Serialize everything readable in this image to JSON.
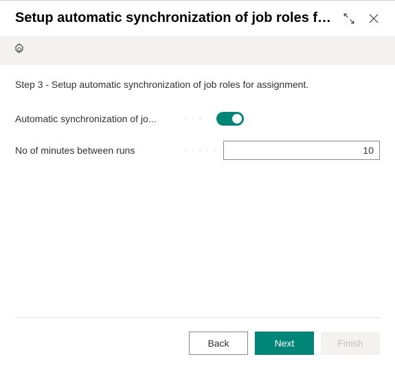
{
  "header": {
    "title": "Setup automatic synchronization of job roles fo..."
  },
  "step": {
    "text": "Step 3 - Setup automatic synchronization of job roles for assignment."
  },
  "form": {
    "auto_sync_label": "Automatic synchronization of jo...",
    "auto_sync_enabled": true,
    "minutes_label": "No of minutes between runs",
    "minutes_value": "10"
  },
  "buttons": {
    "back": "Back",
    "next": "Next",
    "finish": "Finish"
  }
}
